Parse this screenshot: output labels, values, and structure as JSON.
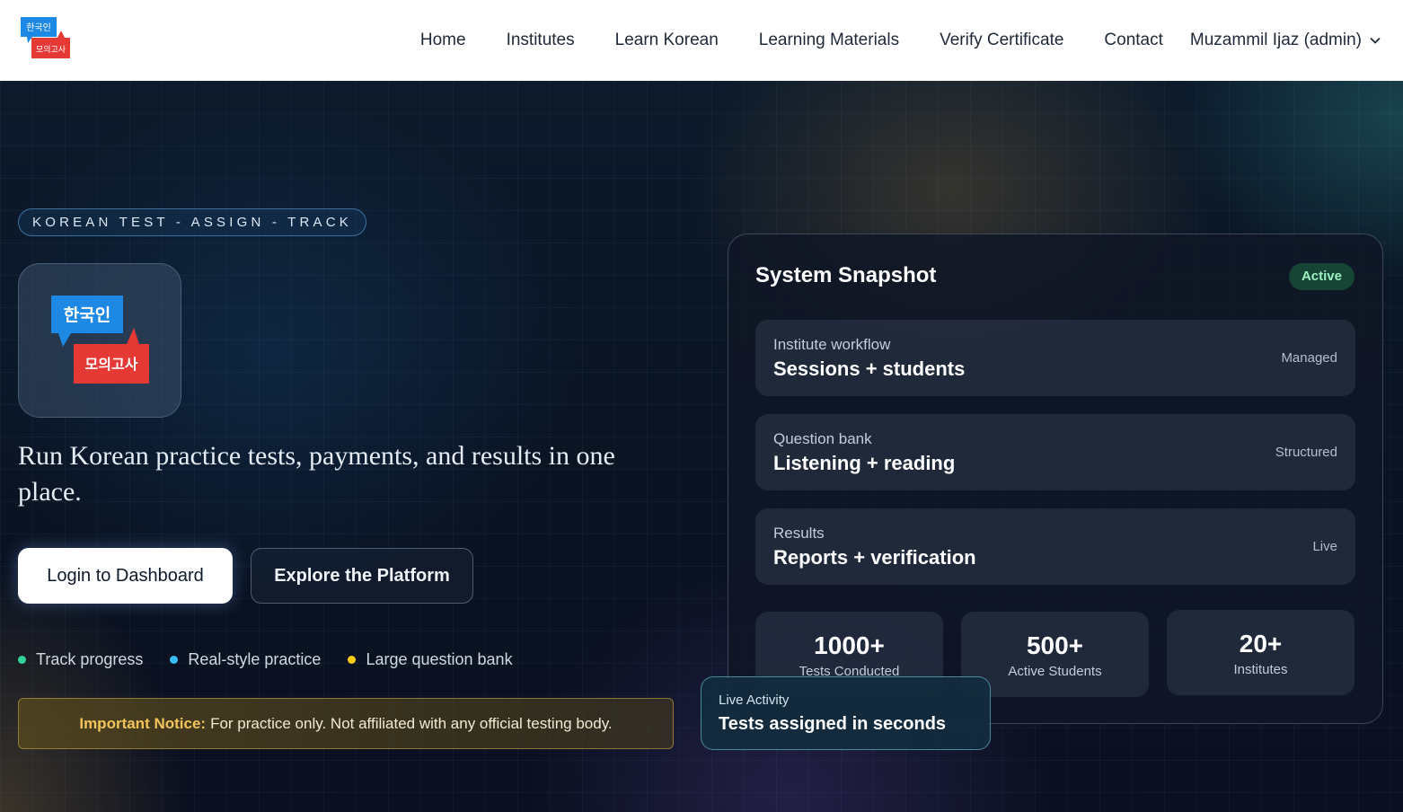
{
  "logo": {
    "top_text": "한국인",
    "bottom_text": "모의고사"
  },
  "nav": {
    "links": [
      "Home",
      "Institutes",
      "Learn Korean",
      "Learning Materials",
      "Verify Certificate",
      "Contact"
    ],
    "user": "Muzammil Ijaz (admin)"
  },
  "hero": {
    "eyebrow": "KOREAN TEST - ASSIGN - TRACK",
    "headline": "Run Korean practice tests, payments, and results in one place.",
    "primary_button": "Login to Dashboard",
    "secondary_button": "Explore the Platform",
    "features": [
      {
        "label": "Track progress",
        "color": "#34d399"
      },
      {
        "label": "Real-style practice",
        "color": "#38bdf8"
      },
      {
        "label": "Large question bank",
        "color": "#facc15"
      }
    ],
    "notice": {
      "title": "Important Notice:",
      "text": "For practice only. Not affiliated with any official testing body."
    }
  },
  "snapshot": {
    "title": "System Snapshot",
    "badge": "Active",
    "rows": [
      {
        "label": "Institute workflow",
        "value": "Sessions + students",
        "status": "Managed"
      },
      {
        "label": "Question bank",
        "value": "Listening + reading",
        "status": "Structured"
      },
      {
        "label": "Results",
        "value": "Reports + verification",
        "status": "Live"
      }
    ],
    "stats": [
      {
        "value": "1000+",
        "label": "Tests Conducted"
      },
      {
        "value": "500+",
        "label": "Active Students"
      },
      {
        "value": "20+",
        "label": "Institutes"
      }
    ]
  },
  "live_activity": {
    "label": "Live Activity",
    "value": "Tests assigned in seconds"
  },
  "colors": {
    "logo_blue": "#1e88e5",
    "logo_red": "#e53935",
    "active_green": "#9ff0c1"
  }
}
